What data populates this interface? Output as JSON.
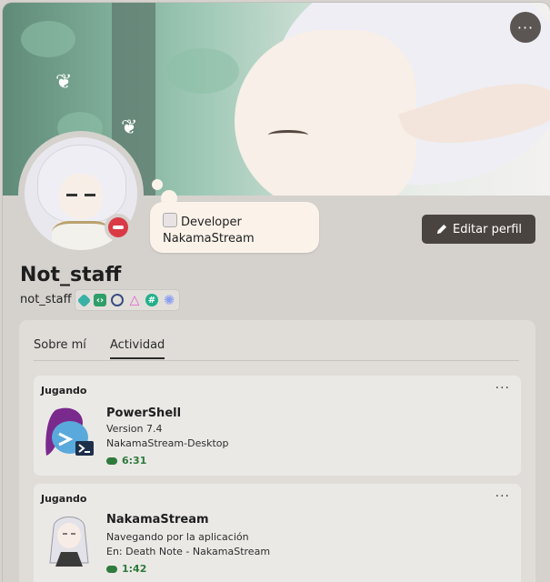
{
  "header": {
    "more_label": "···"
  },
  "status_bubble": {
    "line1": "Developer",
    "line2": "NakamaStream"
  },
  "edit_button": {
    "label": "Editar perfil"
  },
  "profile": {
    "display_name": "Not_staff",
    "username": "not_staff"
  },
  "badges": [
    {
      "icon": "diamond-badge-icon",
      "color": "#39b1a6"
    },
    {
      "icon": "code-badge-icon",
      "color": "#2f9e68"
    },
    {
      "icon": "ring-badge-icon",
      "color": "#3a4c82"
    },
    {
      "icon": "triangle-badge-icon",
      "color": "#e25bd0"
    },
    {
      "icon": "hashtag-badge-icon",
      "color": "#24b08b"
    },
    {
      "icon": "gear-badge-icon",
      "color": "#8a9ef2"
    }
  ],
  "tabs": [
    {
      "label": "Sobre mí",
      "active": false
    },
    {
      "label": "Actividad",
      "active": true
    }
  ],
  "activities": [
    {
      "heading": "Jugando",
      "more_label": "···",
      "icon": "powershell-icon",
      "name": "PowerShell",
      "details": "Version 7.4",
      "state": "NakamaStream-Desktop",
      "elapsed": "6:31"
    },
    {
      "heading": "Jugando",
      "more_label": "···",
      "icon": "nakamastream-icon",
      "name": "NakamaStream",
      "details": "Navegando por la aplicación",
      "state": "En: Death Note - NakamaStream",
      "elapsed": "1:42"
    }
  ],
  "colors": {
    "accent_green": "#2f7a3c",
    "dnd_red": "#d93a45",
    "edit_button_bg": "#4a4441"
  }
}
